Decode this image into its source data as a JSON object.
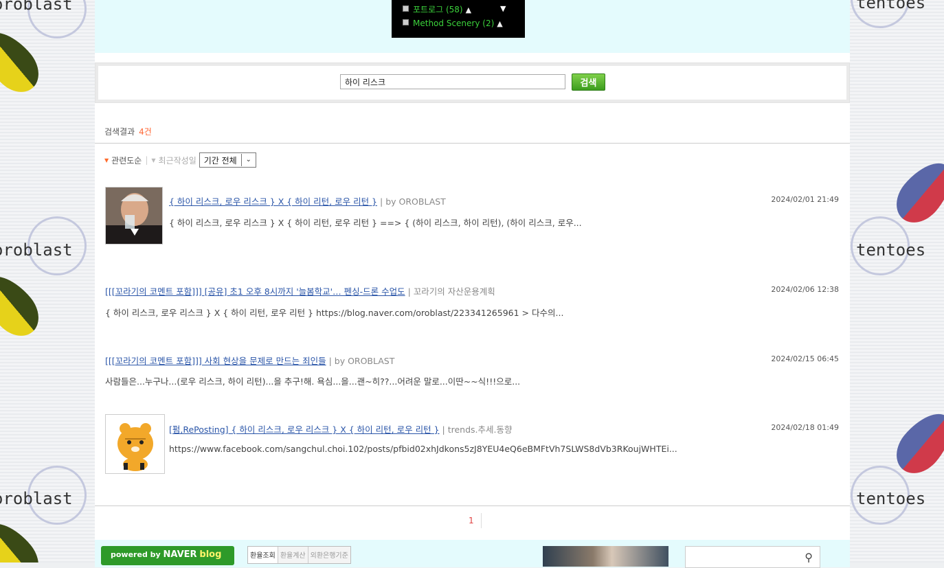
{
  "deco": {
    "left_text": "oroblast",
    "right_text": "tentoes"
  },
  "categories": [
    {
      "label": "포트로그 (58)",
      "locked": true
    },
    {
      "label": "Method Scenery (2)",
      "locked": true
    }
  ],
  "search": {
    "query": "하이 리스크",
    "button_label": "검색"
  },
  "results": {
    "label": "검색결과",
    "count": "4건"
  },
  "sort": {
    "relevance": "관련도순",
    "recent": "최근작성일",
    "period": "기간 전체"
  },
  "posts": [
    {
      "title": "{ 하이 리스크, 로우 리스크 } X { 하이 리턴, 로우 리턴 }",
      "source": "| by OROBLAST",
      "date": "2024/02/01 21:49",
      "snippet": "{ 하이 리스크, 로우 리스크 } X { 하이 리턴, 로우 리턴 } ==> { (하이 리스크, 하이 리턴), (하이 리스크, 로우..."
    },
    {
      "title": "[[[꼬라기의 코멘트 포함]]] [공유] 초1 오후 8시까지 '늘봄학교'… 펜싱-드론 수업도",
      "source": "| 꼬라기의 자산운용계획",
      "date": "2024/02/06 12:38",
      "snippet": "{ 하이 리스크, 로우 리스크 } X { 하이 리턴, 로우 리턴 } https://blog.naver.com/oroblast/223341265961 > 다수의..."
    },
    {
      "title": "[[[꼬라기의 코멘트 포함]]] 사회 현상을 문제로 만드는 죄인들",
      "source": "| by OROBLAST",
      "date": "2024/02/15 06:45",
      "snippet": "사람들은...누구나...(로우 리스크, 하이 리턴)...을 추구!해. 욕심...을...괜~히??...어려운 말로...이딴~~식!!!으로..."
    },
    {
      "title": "[펌,RePosting] { 하이 리스크, 로우 리스크 } X { 하이 리턴, 로우 리턴 }",
      "source": "| trends.추세.동향",
      "date": "2024/02/18 01:49",
      "snippet": "https://www.facebook.com/sangchul.choi.102/posts/pfbid02xhJdkons5zJ8YEU4eQ6eBMFtVh7SLWS8dVb3RKoujWHTEi..."
    }
  ],
  "pagination": {
    "current": "1"
  },
  "footer": {
    "badge_prefix": "powered by",
    "badge_brand": "NAVER",
    "badge_blog": "blog",
    "fx_tabs": [
      "환율조회",
      "환율계산",
      "외환은행기준"
    ]
  },
  "colors": {
    "accent_green": "#3bd13b",
    "link_blue": "#2a55a8",
    "count_orange": "#ff6633",
    "band": "#e4fbfd"
  }
}
